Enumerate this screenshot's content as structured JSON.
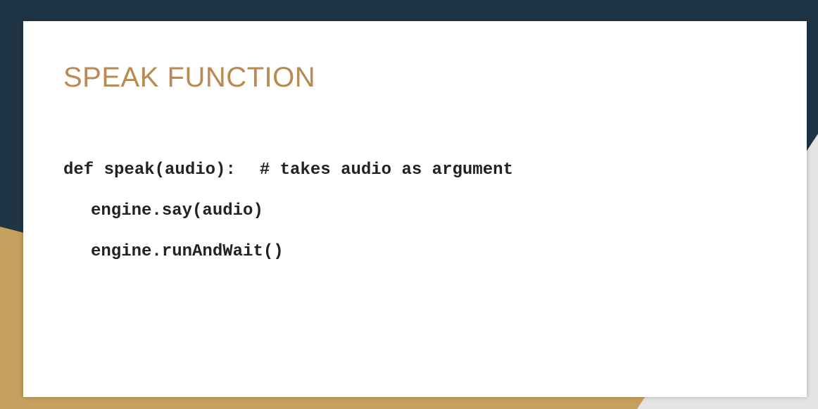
{
  "slide": {
    "title": "SPEAK FUNCTION",
    "code": {
      "line1_code": "def speak(audio):",
      "line1_comment": "# takes audio as argument",
      "line2": "engine.say(audio)",
      "line3": "engine.runAndWait()"
    }
  },
  "colors": {
    "background_navy": "#1f3444",
    "accent_gold": "#c6a05e",
    "accent_light_gray": "#e4e4e4",
    "title_color": "#b98a52",
    "code_color": "#222222",
    "card_white": "#ffffff"
  }
}
